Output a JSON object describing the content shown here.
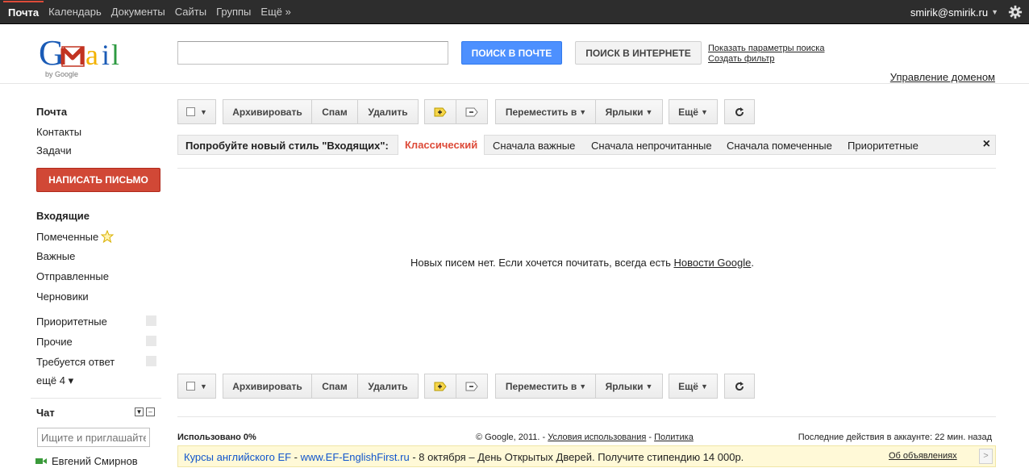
{
  "topnav": {
    "items": [
      "Почта",
      "Календарь",
      "Документы",
      "Сайты",
      "Группы",
      "Ещё »"
    ],
    "account": "smirik@smirik.ru"
  },
  "header": {
    "logo_text": "Gmail",
    "logo_sub": "by Google",
    "search_placeholder": "",
    "search_mail_button": "ПОИСК В ПОЧТЕ",
    "search_web_button": "ПОИСК В ИНТЕРНЕТЕ",
    "show_search_options": "Показать параметры поиска",
    "create_filter": "Создать фильтр",
    "domain_management": "Управление доменом"
  },
  "sidebar": {
    "apps": [
      "Почта",
      "Контакты",
      "Задачи"
    ],
    "compose": "НАПИСАТЬ ПИСЬМО",
    "folders": [
      "Входящие",
      "Помеченные",
      "Важные",
      "Отправленные",
      "Черновики"
    ],
    "labels": [
      "Приоритетные",
      "Прочие",
      "Требуется ответ"
    ],
    "more": "ещё 4 ▾",
    "chat_title": "Чат",
    "chat_search_placeholder": "Ищите и приглашайте",
    "chat_contact": "Евгений Смирнов"
  },
  "toolbar": {
    "archive": "Архивировать",
    "spam": "Спам",
    "delete": "Удалить",
    "move_to": "Переместить в",
    "labels": "Ярлыки",
    "more": "Ещё"
  },
  "inbox_type": {
    "prompt": "Попробуйте новый стиль \"Входящих\":",
    "tabs": [
      "Классический",
      "Сначала важные",
      "Сначала непрочитанные",
      "Сначала помеченные",
      "Приоритетные"
    ],
    "close": "×"
  },
  "empty": {
    "text": "Новых писем нет. Если хочется почитать, всегда есть ",
    "link": "Новости Google",
    "tail": "."
  },
  "footer": {
    "usage": "Использовано 0%",
    "copyright": "© Google, 2011. - ",
    "terms": "Условия использования",
    "sep": " - ",
    "privacy": "Политика",
    "last_activity": "Последние действия в аккаунте: 22 мин. назад"
  },
  "ad": {
    "title": "Курсы английского EF",
    "dash": " - ",
    "url": "www.EF-EnglishFirst.ru",
    "text": " - 8 октября – День Открытых Дверей. Получите стипендию 14 000р.",
    "about": "Об объявлениях",
    "next": ">"
  },
  "colors": {
    "topbar": "#2d2d2d",
    "search_blue": "#4d90fe",
    "compose_red": "#d14836",
    "selected_tab": "#dd4b39",
    "ad_bg": "#fff9d7"
  }
}
